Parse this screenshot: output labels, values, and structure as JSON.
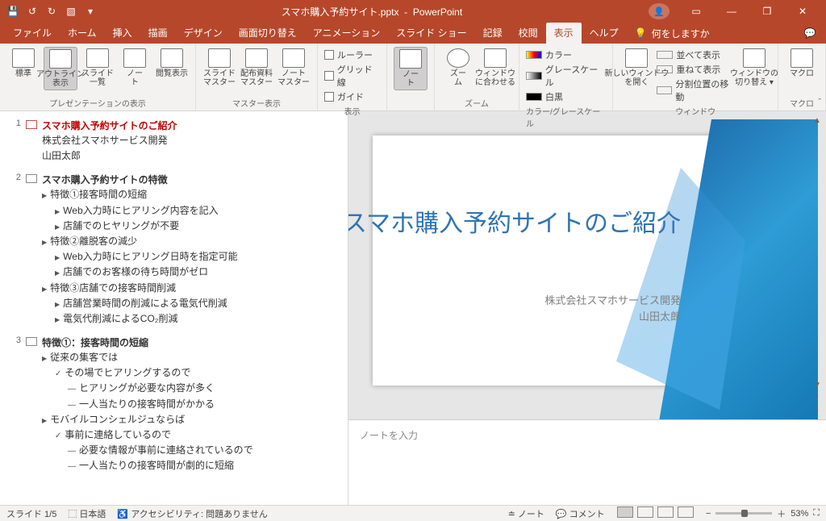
{
  "title": {
    "filename": "スマホ購入予約サイト.pptx",
    "app": "PowerPoint"
  },
  "qat": {
    "save": "save-icon",
    "undo": "undo-icon",
    "redo": "redo-icon",
    "start": "from-beginning-icon"
  },
  "win": {
    "minimize": "—",
    "restore": "❐",
    "close": "✕",
    "ribbonmode": "▭"
  },
  "tabs": {
    "file": "ファイル",
    "home": "ホーム",
    "insert": "挿入",
    "draw": "描画",
    "design": "デザイン",
    "transitions": "画面切り替え",
    "animations": "アニメーション",
    "slideshow": "スライド ショー",
    "record": "記録",
    "review": "校閲",
    "view": "表示",
    "help": "ヘルプ",
    "tell_icon": "💡",
    "tell": "何をしますか"
  },
  "ribbon": {
    "views": {
      "normal": "標準",
      "outline": "アウトライン\n表示",
      "sorter": "スライド\n一覧",
      "notes": "ノー\nト",
      "reading": "閲覧表示",
      "group": "プレゼンテーションの表示"
    },
    "masters": {
      "slide": "スライド\nマスター",
      "handout": "配布資料\nマスター",
      "notes": "ノート\nマスター",
      "group": "マスター表示"
    },
    "show": {
      "ruler": "ルーラー",
      "gridlines": "グリッド線",
      "guides": "ガイド",
      "group": "表示"
    },
    "notespane": {
      "btn": "ノー\nト"
    },
    "zoom": {
      "zoom": "ズー\nム",
      "fit": "ウィンドウ\nに合わせる",
      "group": "ズーム"
    },
    "color": {
      "color": "カラー",
      "gray": "グレースケール",
      "bw": "白黒",
      "group": "カラー/グレースケール"
    },
    "window": {
      "new": "新しいウィンドウ\nを開く",
      "arrange": "並べて表示",
      "cascade": "重ねて表示",
      "split": "分割位置の移動",
      "switch": "ウィンドウの\n切り替え ▾",
      "group": "ウィンドウ"
    },
    "macros": {
      "btn": "マクロ",
      "group": "マクロ"
    },
    "collapse": "ˆ"
  },
  "outline": {
    "s1": {
      "num": "1",
      "title": "スマホ購入予約サイトのご紹介",
      "l1": "株式会社スマホサービス開発",
      "l2": "山田太郎"
    },
    "s2": {
      "num": "2",
      "title": "スマホ購入予約サイトの特徴",
      "a": "特徴①接客時間の短縮",
      "a1": "Web入力時にヒアリング内容を記入",
      "a2": "店舗でのヒヤリングが不要",
      "b": "特徴②離脱客の減少",
      "b1": "Web入力時にヒアリング日時を指定可能",
      "b2": "店舗でのお客様の待ち時間がゼロ",
      "c": "特徴③店舗での接客時間削減",
      "c1": "店舗営業時間の削減による電気代削減",
      "c2": "電気代削減によるCO₂削減"
    },
    "s3": {
      "num": "3",
      "title": "特徴①：接客時間の短縮",
      "a": "従来の集客では",
      "a1": "その場でヒアリングするので",
      "a11": "ヒアリングが必要な内容が多く",
      "a12": "一人当たりの接客時間がかかる",
      "b": "モバイルコンシェルジュならば",
      "b1": "事前に連絡しているので",
      "b11": "必要な情報が事前に連絡されているので",
      "b12": "一人当たりの接客時間が劇的に短縮"
    }
  },
  "slide": {
    "title": "スマホ購入予約サイトのご紹介",
    "sub1": "株式会社スマホサービス開発",
    "sub2": "山田太郎"
  },
  "notes": {
    "placeholder": "ノートを入力"
  },
  "status": {
    "slide": "スライド 1/5",
    "lang_icon": "⬚",
    "lang": "日本語",
    "acc_icon": "♿",
    "acc": "アクセシビリティ: 問題ありません",
    "notes_icon": "≐",
    "notes": "ノート",
    "comments_icon": "💬",
    "comments": "コメント",
    "zoom_out": "−",
    "zoom_in": "＋",
    "zoom": "53%",
    "fit": "⛶"
  }
}
